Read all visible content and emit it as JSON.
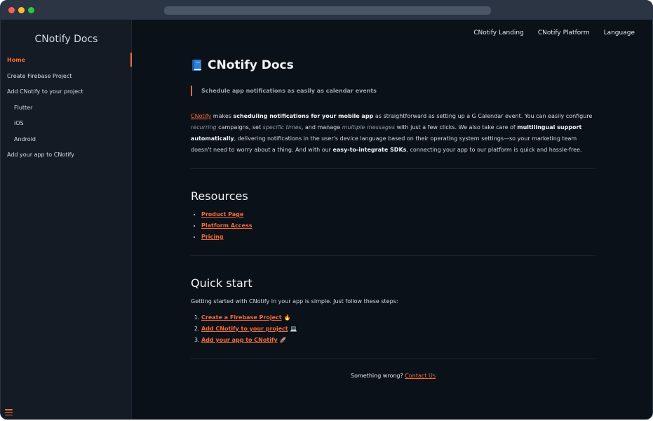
{
  "sidebar": {
    "title": "CNotify Docs",
    "items": [
      {
        "label": "Home",
        "active": true,
        "indent": false
      },
      {
        "label": "Create Firebase Project",
        "active": false,
        "indent": false
      },
      {
        "label": "Add CNotify to your project",
        "active": false,
        "indent": false
      },
      {
        "label": "Flutter",
        "active": false,
        "indent": true
      },
      {
        "label": "iOS",
        "active": false,
        "indent": true
      },
      {
        "label": "Android",
        "active": false,
        "indent": true
      },
      {
        "label": "Add your app to CNotify",
        "active": false,
        "indent": false
      }
    ]
  },
  "topnav": {
    "landing": "CNotify Landing",
    "platform": "CNotify Platform",
    "language": "Language"
  },
  "main": {
    "title": "CNotify Docs",
    "tagline": "Schedule app notifications as easily as calendar events",
    "intro": {
      "p1": "CNotify",
      "p2": " makes ",
      "p3": "scheduling notifications for your mobile app",
      "p4": " as straightforward as setting up a G Calendar event. You can easily configure ",
      "p5": "recurring",
      "p6": " campaigns, set ",
      "p7": "specific times",
      "p8": ", and manage ",
      "p9": "multiple messages",
      "p10": " with just a few clicks. We also take care of ",
      "p11": "multilingual support automatically",
      "p12": ", delivering notifications in the user's device language based on their operating system settings—so your marketing team doesn't need to worry about a thing. And with our ",
      "p13": "easy-to-integrate SDKs",
      "p14": ", connecting your app to our platform is quick and hassle-free."
    },
    "resources": {
      "heading": "Resources",
      "links": [
        "Product Page",
        "Platform Access",
        "Pricing"
      ]
    },
    "quickstart": {
      "heading": "Quick start",
      "intro": "Getting started with CNotify in your app is simple. Just follow these steps:",
      "steps": [
        {
          "label": "Create a Firebase Project",
          "emoji": "🔥"
        },
        {
          "label": "Add CNotify to your project",
          "emoji": "💻"
        },
        {
          "label": "Add your app to CNotify",
          "emoji": "🚀"
        }
      ]
    },
    "footer": {
      "text": "Something wrong? ",
      "link": "Contact Us"
    }
  },
  "colors": {
    "accent": "#f26b3a",
    "background": "#0b1118",
    "sidebar": "#141b24"
  },
  "icons": {
    "title_icon": "book-icon",
    "menu": "menu-icon"
  }
}
